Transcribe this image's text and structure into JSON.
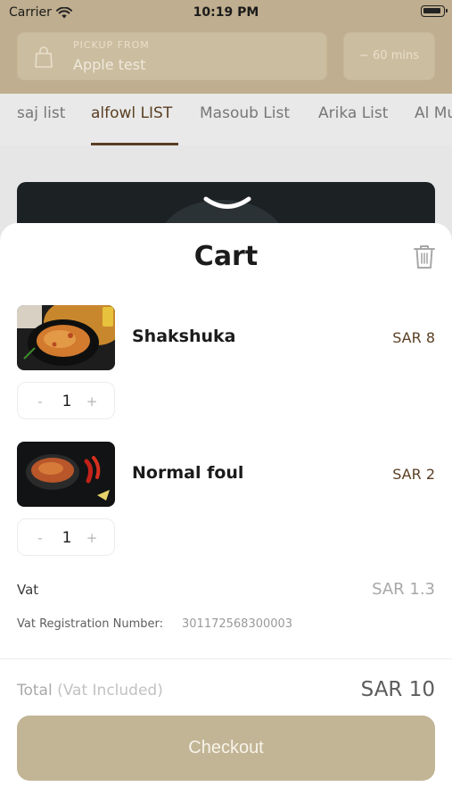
{
  "status_bar": {
    "carrier": "Carrier",
    "time": "10:19 PM"
  },
  "header": {
    "pickup_label": "PICKUP FROM",
    "pickup_value": "Apple test",
    "eta": "~ 60 mins"
  },
  "tabs": [
    {
      "label": "saj list"
    },
    {
      "label": "alfowl LIST",
      "active": true
    },
    {
      "label": "Masoub List"
    },
    {
      "label": "Arika List"
    },
    {
      "label": "Al Mu"
    }
  ],
  "cart": {
    "title": "Cart",
    "items": [
      {
        "name": "Shakshuka",
        "price": "SAR 8",
        "quantity": "1",
        "minus": "-",
        "plus": "+"
      },
      {
        "name": "Normal foul",
        "price": "SAR 2",
        "quantity": "1",
        "minus": "-",
        "plus": "+"
      }
    ],
    "vat_label": "Vat",
    "vat_value": "SAR 1.3",
    "vat_reg_label": "Vat Registration Number:",
    "vat_reg_value": "301172568300003",
    "total_label": "Total",
    "total_note": "(Vat Included)",
    "total_value": "SAR 10",
    "checkout_label": "Checkout"
  },
  "colors": {
    "accent": "#5a3f23",
    "header_bg": "#bfae8f",
    "checkout_bg": "#c2b595"
  },
  "icons": [
    "wifi-icon",
    "battery-icon",
    "shopping-bag-icon",
    "chevron-down-icon",
    "trash-icon"
  ]
}
